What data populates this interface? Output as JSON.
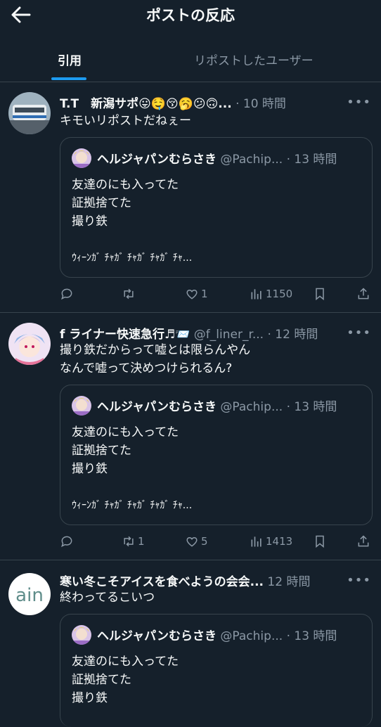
{
  "header": {
    "title": "ポストの反応"
  },
  "tabs": [
    {
      "label": "引用"
    },
    {
      "label": "リポストしたユーザー"
    }
  ],
  "quoted": {
    "name": "ヘルジャパンむらさき",
    "handle": "@Pachip...",
    "time": "· 13 時間",
    "lines": [
      "友達のにも入ってた",
      "証拠捨てた",
      "撮り鉄"
    ],
    "last": "ｳｨｰﾝｶﾞ ﾁｬｶﾞ ﾁｬｶﾞ ﾁｬｶﾞ ﾁｬ..."
  },
  "posts": [
    {
      "name": "T.T　新潟サポ😛🤤😚🥱😕🙃...",
      "handle": "",
      "time": "· 10 時間",
      "text": [
        "キモいリポストだねぇー"
      ],
      "replies": "",
      "reposts": "",
      "likes": "1",
      "views": "1150"
    },
    {
      "name": "f ライナー快速急行♬📨",
      "handle": "@f_liner_r...",
      "time": "· 12 時間",
      "text": [
        "撮り鉄だからって嘘とは限らんやん",
        "なんで嘘って決めつけられるん?"
      ],
      "replies": "",
      "reposts": "1",
      "likes": "5",
      "views": "1413"
    },
    {
      "name": "寒い冬こそアイスを食べようの会会...",
      "handle": "",
      "time": "12 時間",
      "text": [
        "終わってるこいつ"
      ],
      "replies": "",
      "reposts": "",
      "likes": "",
      "views": ""
    }
  ],
  "avatar3_text": "ain",
  "colors": {
    "background": "#15202b",
    "accent": "#1d9bf0",
    "muted": "#8b98a5",
    "border": "#38444d"
  }
}
